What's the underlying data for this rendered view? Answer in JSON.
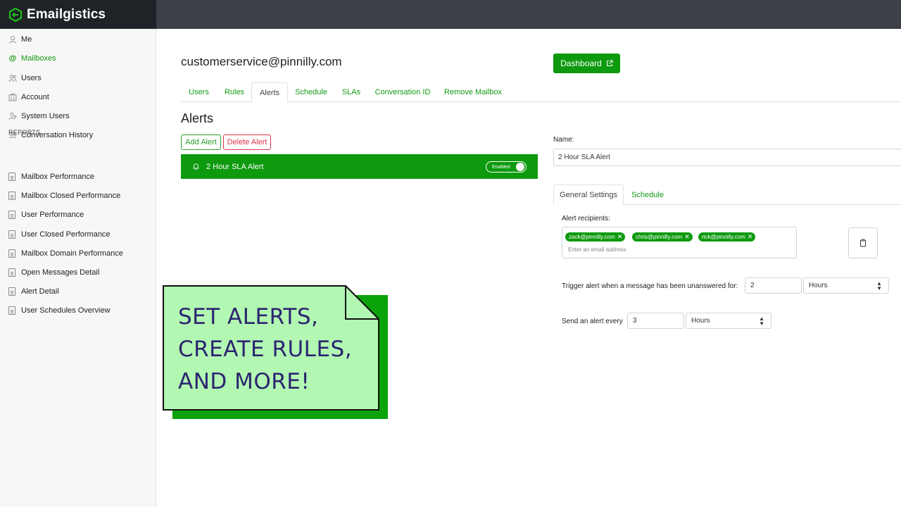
{
  "brand": {
    "name": "Emailgistics"
  },
  "sidebar": {
    "items": [
      {
        "label": "Me",
        "icon": "user-icon",
        "active": false
      },
      {
        "label": "Mailboxes",
        "icon": "at-icon",
        "active": true
      },
      {
        "label": "Users",
        "icon": "users-icon",
        "active": false
      },
      {
        "label": "Account",
        "icon": "building-icon",
        "active": false
      },
      {
        "label": "System Users",
        "icon": "system-users-icon",
        "active": false
      },
      {
        "label": "Conversation History",
        "icon": "list-icon",
        "active": false
      }
    ],
    "reports_label": "REPORTS",
    "reports": [
      {
        "label": "Mailbox Performance"
      },
      {
        "label": "Mailbox Closed Performance"
      },
      {
        "label": "User Performance"
      },
      {
        "label": "User Closed Performance"
      },
      {
        "label": "Mailbox Domain Performance"
      },
      {
        "label": "Open Messages Detail"
      },
      {
        "label": "Alert Detail"
      },
      {
        "label": "User Schedules Overview"
      }
    ]
  },
  "main": {
    "mailbox_title": "customerservice@pinnilly.com",
    "dashboard_label": "Dashboard",
    "tabs": [
      {
        "label": "Users"
      },
      {
        "label": "Rules"
      },
      {
        "label": "Alerts",
        "active": true
      },
      {
        "label": "Schedule"
      },
      {
        "label": "SLAs"
      },
      {
        "label": "Conversation ID"
      },
      {
        "label": "Remove Mailbox"
      }
    ],
    "heading": "Alerts",
    "add_alert_label": "Add Alert",
    "delete_alert_label": "Delete Alert",
    "alert_row": {
      "name": "2 Hour SLA Alert",
      "toggle_label": "Enabled",
      "enabled": true
    }
  },
  "form": {
    "name_label": "Name:",
    "name_value": "2 Hour SLA Alert",
    "subtabs": [
      {
        "label": "General Settings",
        "active": true
      },
      {
        "label": "Schedule"
      }
    ],
    "recipients_label": "Alert recipients:",
    "recipients": [
      "zack@pinnilly.com",
      "chris@pinnilly.com",
      "rick@pinnilly.com"
    ],
    "recipients_placeholder": "Enter an email address",
    "trigger_label": "Trigger alert when a message has been unanswered for:",
    "trigger_value": "2",
    "trigger_unit": "Hours",
    "send_label": "Send an alert every",
    "send_value": "3",
    "send_unit": "Hours"
  },
  "promo": {
    "lines": [
      "SET ALERTS,",
      "CREATE RULES,",
      "AND MORE!"
    ]
  },
  "colors": {
    "accent": "#0e9a0e",
    "topbar": "#3d4147",
    "brand_bar": "#1f2327",
    "note_fill": "#b2f7b2",
    "note_text": "#2c2470",
    "danger": "#dc3545"
  }
}
